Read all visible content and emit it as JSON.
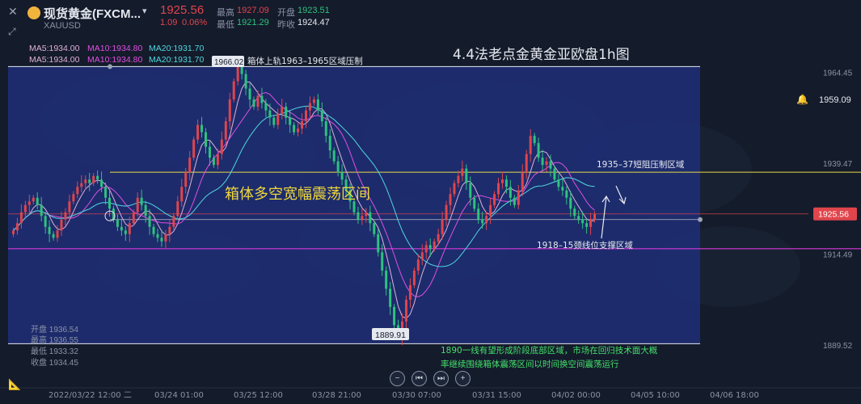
{
  "header": {
    "symbol": "现货黄金(FXCM...",
    "code": "XAUUSD",
    "price": "1925.56",
    "change": "1.09",
    "change_pct": "0.06%",
    "high_label": "最高",
    "high": "1927.09",
    "open_label": "开盘",
    "open": "1923.51",
    "low_label": "最低",
    "low": "1921.29",
    "prev_close_label": "昨收",
    "prev_close": "1924.47"
  },
  "ma_rows": [
    {
      "ma5": "MA5:1934.00",
      "ma10": "MA10:1934.80",
      "ma20": "MA20:1931.70"
    },
    {
      "ma5": "MA5:1934.00",
      "ma10": "MA10:1934.80",
      "ma20": "MA20:1931.70"
    }
  ],
  "ohlc_panel": {
    "open": "开盘 1936.54",
    "high": "最高 1936.55",
    "low": "最低 1933.32",
    "close": "收盘 1934.45"
  },
  "alert_price": "1959.09",
  "current_price_tag": "1925.56",
  "nav_buttons": [
    "−",
    "⏮",
    "⏭",
    "+"
  ],
  "icons": {
    "close": "close-icon",
    "expand": "expand-icon",
    "bell": "bell-icon",
    "ruler": "ruler-icon",
    "coin": "gold-coin-icon"
  },
  "colors": {
    "background": "#141b2b",
    "box": "#1f2e78",
    "up": "#e0454c",
    "down": "#2ec27e",
    "ma5": "#e0b0d8",
    "ma10": "#e04fe0",
    "ma20": "#4fd8e0",
    "resistance": "#e8d84a",
    "support": "#d838d8",
    "price_tag": "#e0454c"
  },
  "chart_data": {
    "type": "candlestick",
    "title": "4.4法老点金黄金亚欧盘1h图",
    "ylim": [
      1880,
      1971
    ],
    "y_ticks": [
      1964.45,
      1939.47,
      1914.49,
      1889.52
    ],
    "x_ticks": [
      "2022/03/22 12:00 二",
      "03/24 01:00",
      "03/25 12:00",
      "03/28 21:00",
      "03/30 07:00",
      "03/31 15:00",
      "04/02 00:00",
      "04/05 10:00",
      "04/06 18:00"
    ],
    "candles_close": [
      1921,
      1923,
      1926,
      1928,
      1929,
      1930,
      1928,
      1925,
      1922,
      1920,
      1919,
      1921,
      1924,
      1926,
      1929,
      1931,
      1933,
      1934,
      1935,
      1934,
      1936,
      1935,
      1933,
      1930,
      1927,
      1924,
      1922,
      1921,
      1920,
      1923,
      1926,
      1930,
      1928,
      1925,
      1922,
      1920,
      1919,
      1918,
      1920,
      1922,
      1925,
      1929,
      1933,
      1937,
      1941,
      1946,
      1950,
      1948,
      1944,
      1941,
      1939,
      1942,
      1946,
      1951,
      1957,
      1962,
      1966,
      1964,
      1960,
      1957,
      1955,
      1958,
      1956,
      1954,
      1952,
      1950,
      1953,
      1955,
      1952,
      1950,
      1948,
      1949,
      1951,
      1954,
      1956,
      1957,
      1954,
      1951,
      1947,
      1943,
      1940,
      1937,
      1935,
      1932,
      1929,
      1926,
      1924,
      1925,
      1926,
      1923,
      1920,
      1915,
      1910,
      1905,
      1900,
      1895,
      1891,
      1896,
      1902,
      1906,
      1910,
      1913,
      1915,
      1917,
      1916,
      1918,
      1920,
      1924,
      1928,
      1931,
      1934,
      1936,
      1938,
      1934,
      1930,
      1927,
      1924,
      1923,
      1925,
      1928,
      1931,
      1934,
      1935,
      1933,
      1930,
      1928,
      1932,
      1937,
      1942,
      1947,
      1945,
      1941,
      1939,
      1940,
      1938,
      1935,
      1933,
      1932,
      1930,
      1927,
      1925,
      1924,
      1923,
      1922,
      1924,
      1925.56
    ],
    "labels": {
      "box_top_value": "1966.02",
      "box_low_value": "1889.91",
      "box_upper_note": "箱体上轨1963–1965区域压制",
      "range_text": "箱体多空宽幅震荡区间",
      "resistance_note": "1935–37短阻压制区域",
      "support_note": "1918–15颈线位支撑区域",
      "bottom_note_1": "1890一线有望形成阶段底部区域，市场在回归技术面大概",
      "bottom_note_2": "率继续围绕箱体震荡区间以时间换空间震荡运行"
    },
    "levels": {
      "box_top": 1966.02,
      "box_bottom": 1889.91,
      "resistance": 1937,
      "support": 1916,
      "current": 1925.56,
      "current_band": 1924
    },
    "grid": false,
    "legend": "top-left"
  }
}
